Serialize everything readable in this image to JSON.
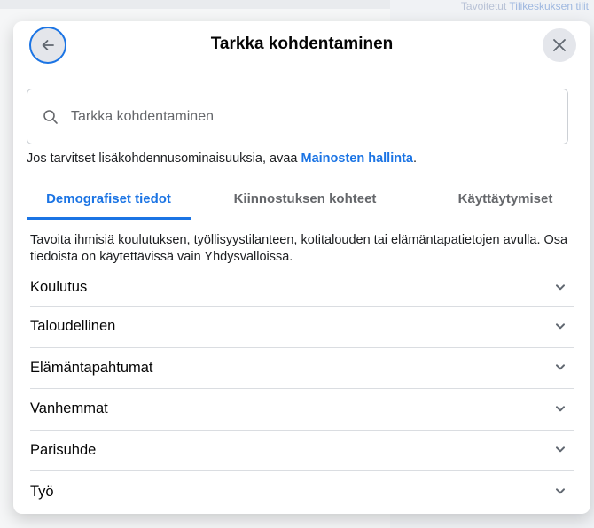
{
  "background": {
    "top_text_prefix": "Tavoitetut",
    "top_text_link": "Tilikeskuksen tilit"
  },
  "modal": {
    "title": "Tarkka kohdentaminen",
    "search": {
      "placeholder": "Tarkka kohdentaminen",
      "value": ""
    },
    "info": {
      "text": "Jos tarvitset lisäkohdennusominaisuuksia, avaa",
      "link": "Mainosten hallinta",
      "suffix": "."
    },
    "tabs": [
      {
        "label": "Demografiset tiedot",
        "active": true
      },
      {
        "label": "Kiinnostuksen kohteet",
        "active": false
      },
      {
        "label": "Käyttäytymiset",
        "active": false
      }
    ],
    "description": "Tavoita ihmisiä koulutuksen, työllisyystilanteen, kotitalouden tai elämäntapatietojen avulla. Osa tiedoista on käytettävissä vain Yhdysvalloissa.",
    "categories": [
      {
        "label": "Koulutus"
      },
      {
        "label": "Taloudellinen"
      },
      {
        "label": "Elämäntapahtumat"
      },
      {
        "label": "Vanhemmat"
      },
      {
        "label": "Parisuhde"
      },
      {
        "label": "Työ"
      }
    ]
  },
  "colors": {
    "accent": "#1b74e4",
    "button_bg": "#e4e6eb"
  },
  "icons": {
    "back": "arrow-left-icon",
    "close": "close-icon",
    "search": "search-icon",
    "expand": "chevron-down-icon"
  }
}
